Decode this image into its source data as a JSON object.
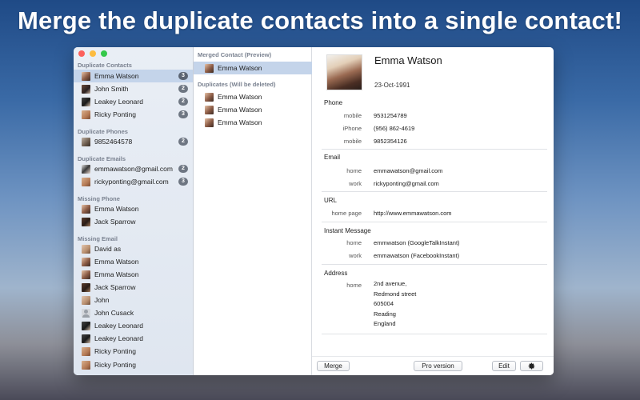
{
  "headline": "Merge the duplicate contacts into a single contact!",
  "sidebar": {
    "sections": [
      {
        "title": "Duplicate Contacts",
        "items": [
          {
            "label": "Emma Watson",
            "count": "3",
            "avatar": "emma",
            "selected": true
          },
          {
            "label": "John Smith",
            "count": "2",
            "avatar": "john"
          },
          {
            "label": "Leakey Leonard",
            "count": "2",
            "avatar": "leakey"
          },
          {
            "label": "Ricky Ponting",
            "count": "3",
            "avatar": "ricky"
          }
        ]
      },
      {
        "title": "Duplicate Phones",
        "items": [
          {
            "label": "9852464578",
            "count": "2",
            "avatar": "phone"
          }
        ]
      },
      {
        "title": "Duplicate Emails",
        "items": [
          {
            "label": "emmawatson@gmail.com",
            "count": "2",
            "avatar": "email1"
          },
          {
            "label": "rickyponting@gmail.com",
            "count": "3",
            "avatar": "ricky"
          }
        ]
      },
      {
        "title": "Missing Phone",
        "items": [
          {
            "label": "Emma Watson",
            "avatar": "emma"
          },
          {
            "label": "Jack Sparrow",
            "avatar": "jack"
          }
        ]
      },
      {
        "title": "Missing Email",
        "items": [
          {
            "label": "David as",
            "avatar": "david"
          },
          {
            "label": "Emma Watson",
            "avatar": "emma"
          },
          {
            "label": "Emma Watson",
            "avatar": "emma"
          },
          {
            "label": "Jack Sparrow",
            "avatar": "jack"
          },
          {
            "label": "John",
            "avatar": "david"
          },
          {
            "label": "John Cusack",
            "avatar": "generic"
          },
          {
            "label": "Leakey Leonard",
            "avatar": "leakey"
          },
          {
            "label": "Leakey Leonard",
            "avatar": "leakey"
          },
          {
            "label": "Ricky Ponting",
            "avatar": "ricky"
          },
          {
            "label": "Ricky Ponting",
            "avatar": "ricky"
          }
        ]
      }
    ]
  },
  "middle": {
    "merged_title": "Merged Contact (Preview)",
    "merged_item": "Emma Watson",
    "duplicates_title": "Duplicates (Will be deleted)",
    "duplicates": [
      "Emma Watson",
      "Emma Watson",
      "Emma Watson"
    ]
  },
  "detail": {
    "name": "Emma Watson",
    "dob": "23-Oct-1991",
    "phone": {
      "title": "Phone",
      "entries": [
        {
          "label": "mobile",
          "value": "9531254789"
        },
        {
          "label": "iPhone",
          "value": "(956) 862-4619"
        },
        {
          "label": "mobile",
          "value": "9852354126"
        }
      ]
    },
    "email": {
      "title": "Email",
      "entries": [
        {
          "label": "home",
          "value": "emmawatson@gmail.com"
        },
        {
          "label": "work",
          "value": "rickyponting@gmail.com"
        }
      ]
    },
    "url": {
      "title": "URL",
      "entries": [
        {
          "label": "home page",
          "value": "http://www.emmawatson.com"
        }
      ]
    },
    "im": {
      "title": "Instant Message",
      "entries": [
        {
          "label": "home",
          "value": "emmwatson (GoogleTalkInstant)"
        },
        {
          "label": "work",
          "value": "emmawatson (FacebookInstant)"
        }
      ]
    },
    "address": {
      "title": "Address",
      "label": "home",
      "lines": [
        "2nd avenue,",
        "Redmond street",
        "605004",
        "Reading",
        "England"
      ]
    }
  },
  "buttons": {
    "merge": "Merge",
    "pro": "Pro version",
    "edit": "Edit",
    "settings_icon": "gear-icon"
  }
}
